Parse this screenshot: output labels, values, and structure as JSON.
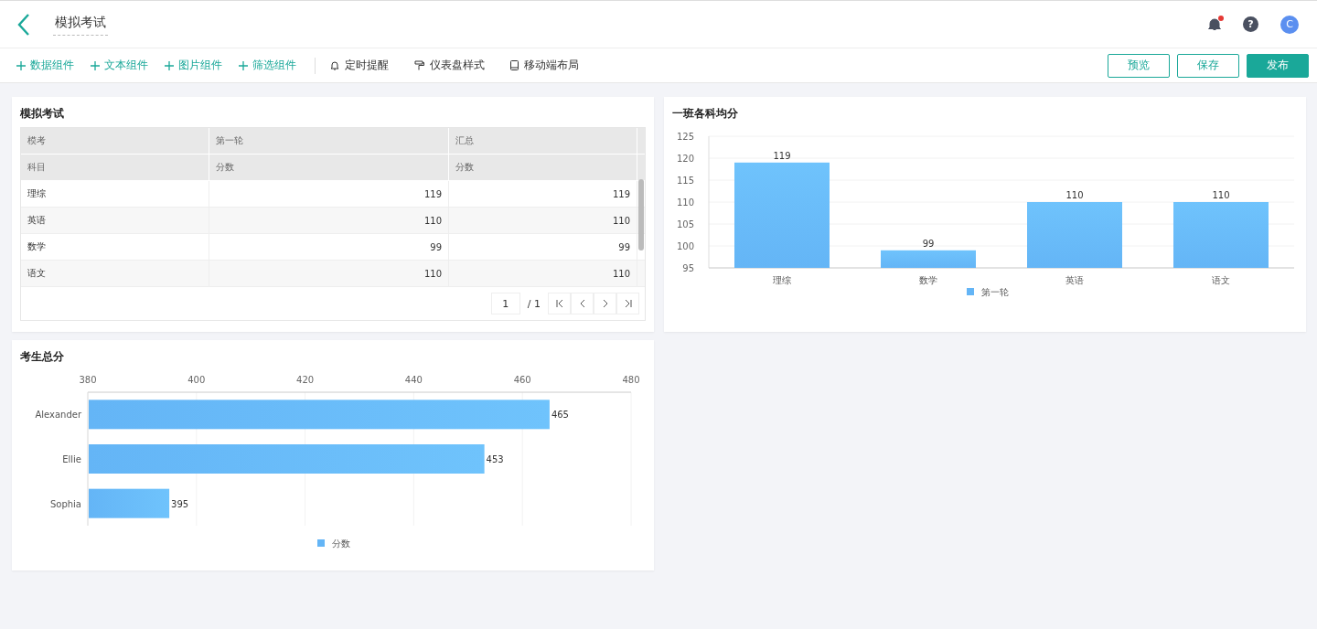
{
  "header": {
    "title": "模拟考试",
    "has_notification": true,
    "help": "?",
    "avatar": "C"
  },
  "toolbar": {
    "add_items": [
      {
        "label": "数据组件"
      },
      {
        "label": "文本组件"
      },
      {
        "label": "图片组件"
      },
      {
        "label": "筛选组件"
      }
    ],
    "tools": [
      {
        "kind": "bell",
        "label": "定时提醒"
      },
      {
        "kind": "brush",
        "label": "仪表盘样式"
      },
      {
        "kind": "phone",
        "label": "移动端布局"
      }
    ],
    "buttons": [
      {
        "kind": "outline",
        "label": "预览"
      },
      {
        "kind": "outline",
        "label": "保存"
      },
      {
        "kind": "primary",
        "label": "发布"
      }
    ]
  },
  "table_card": {
    "title": "模拟考试",
    "header_rows": [
      [
        "模考",
        "第一轮",
        "汇总"
      ],
      [
        "科目",
        "分数",
        "分数"
      ]
    ],
    "rows": [
      [
        "理综",
        "119",
        "119"
      ],
      [
        "英语",
        "110",
        "110"
      ],
      [
        "数学",
        "99",
        "99"
      ],
      [
        "语文",
        "110",
        "110"
      ]
    ],
    "pager": {
      "page": "1",
      "total": "/ 1"
    }
  },
  "bar_card": {
    "chart_data": {
      "type": "bar",
      "title": "一班各科均分",
      "categories": [
        "理综",
        "数学",
        "英语",
        "语文"
      ],
      "series": [
        {
          "name": "第一轮",
          "color": "#64b5f6",
          "values": [
            119,
            99,
            110,
            110
          ]
        }
      ],
      "grid": true,
      "ylim": [
        95,
        125
      ],
      "yticks": [
        95,
        100,
        105,
        110,
        115,
        120,
        125
      ],
      "data_labels": true
    }
  },
  "hbar_card": {
    "chart_data": {
      "type": "bar",
      "orientation": "horizontal",
      "title": "考生总分",
      "categories": [
        "Alexander",
        "Ellie",
        "Sophia"
      ],
      "series": [
        {
          "name": "分数",
          "color": "#64b5f6",
          "values": [
            465,
            453,
            395
          ]
        }
      ],
      "grid": true,
      "xlim": [
        380,
        480
      ],
      "xticks": [
        380,
        400,
        420,
        440,
        460,
        480
      ],
      "data_labels": true
    }
  }
}
